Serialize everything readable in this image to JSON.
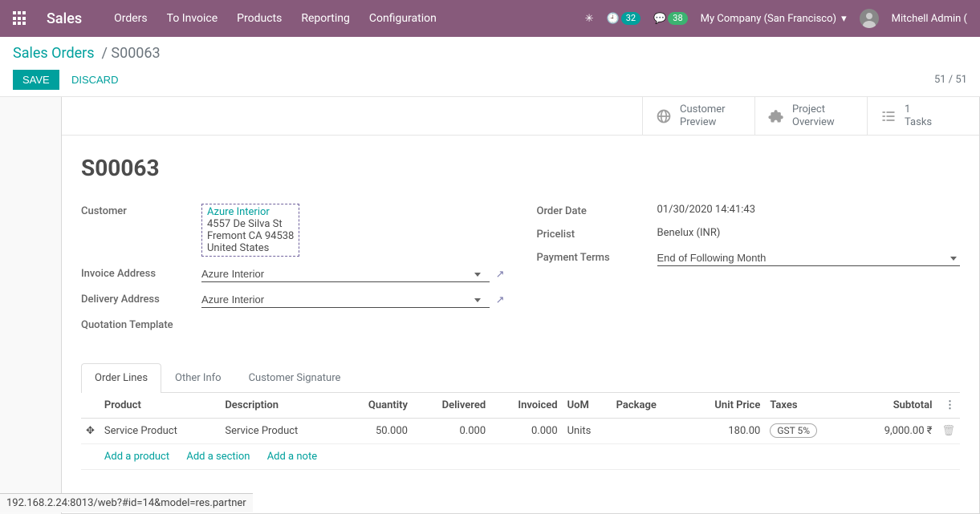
{
  "nav": {
    "brand": "Sales",
    "menu": [
      "Orders",
      "To Invoice",
      "Products",
      "Reporting",
      "Configuration"
    ],
    "badge1": "32",
    "badge2": "38",
    "company": "My Company (San Francisco)",
    "user": "Mitchell Admin ("
  },
  "breadcrumb": {
    "root": "Sales Orders",
    "current": "S00063"
  },
  "actions": {
    "save": "SAVE",
    "discard": "DISCARD"
  },
  "pager": "51 / 51",
  "stats": {
    "preview1": "Customer",
    "preview2": "Preview",
    "project1": "Project",
    "project2": "Overview",
    "tasks_n": "1",
    "tasks": "Tasks"
  },
  "order": {
    "name": "S00063",
    "labels": {
      "customer": "Customer",
      "invoice": "Invoice Address",
      "delivery": "Delivery Address",
      "template": "Quotation Template",
      "orderdate": "Order Date",
      "pricelist": "Pricelist",
      "payterms": "Payment Terms"
    },
    "customer_name": "Azure Interior",
    "customer_addr1": "4557 De Silva St",
    "customer_addr2": "Fremont CA 94538",
    "customer_addr3": "United States",
    "invoice_addr": "Azure Interior",
    "delivery_addr": "Azure Interior",
    "order_date": "01/30/2020 14:41:43",
    "pricelist": "Benelux (INR)",
    "payterms": "End of Following Month"
  },
  "tabs": [
    "Order Lines",
    "Other Info",
    "Customer Signature"
  ],
  "table": {
    "headers": {
      "product": "Product",
      "desc": "Description",
      "qty": "Quantity",
      "delv": "Delivered",
      "inv": "Invoiced",
      "uom": "UoM",
      "pkg": "Package",
      "price": "Unit Price",
      "taxes": "Taxes",
      "subtotal": "Subtotal"
    },
    "row": {
      "product": "Service Product",
      "desc": "Service Product",
      "qty": "50.000",
      "delv": "0.000",
      "inv": "0.000",
      "uom": "Units",
      "pkg": "",
      "price": "180.00",
      "tax": "GST 5%",
      "subtotal": "9,000.00 ₹"
    },
    "add_product": "Add a product",
    "add_section": "Add a section",
    "add_note": "Add a note"
  },
  "footer_url": "192.168.2.24:8013/web?#id=14&model=res.partner"
}
